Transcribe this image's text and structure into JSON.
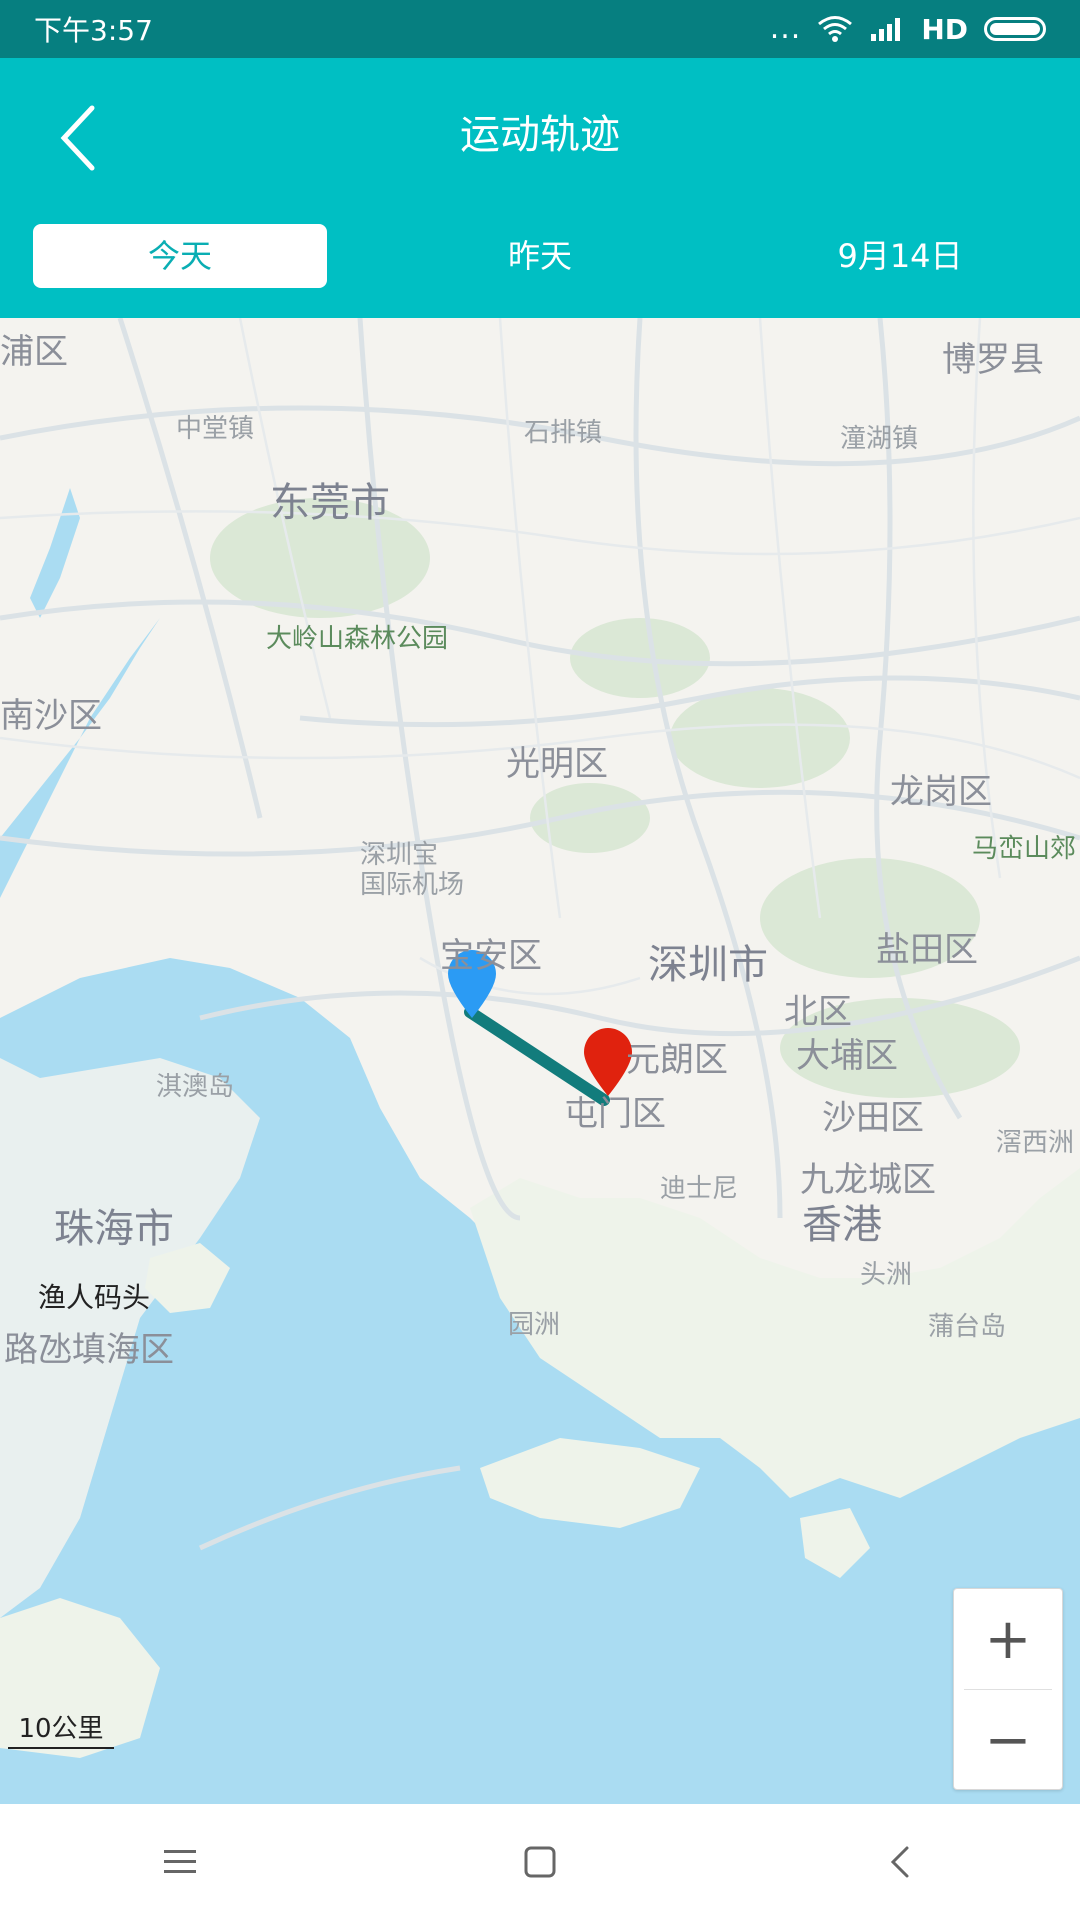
{
  "status": {
    "time": "下午3:57",
    "dots": "...",
    "network": "HD"
  },
  "header": {
    "title": "运动轨迹",
    "back_icon": "chevron-left-icon"
  },
  "tabs": [
    {
      "label": "今天",
      "active": true
    },
    {
      "label": "昨天",
      "active": false
    },
    {
      "label": "9月14日",
      "active": false
    }
  ],
  "map": {
    "labels": {
      "pu": "浦区",
      "boluo": "博罗县",
      "zhongtang": "中堂镇",
      "shipai": "石排镇",
      "tanghu": "潼湖镇",
      "dongguan": "东莞市",
      "daling": "大岭山森林公园",
      "nansha": "南沙区",
      "guangming": "光明区",
      "longgang": "龙岗区",
      "maluanshan": "马峦山郊",
      "airport1": "深圳宝",
      "airport2": "国际机场",
      "baoan": "宝安区",
      "shenzhen": "深圳市",
      "yantian": "盐田区",
      "north": "北区",
      "yuanlang": "元朗区",
      "dapu": "大埔区",
      "qiao": "淇澳岛",
      "tunmen": "屯门区",
      "shatian": "沙田区",
      "xijiao": "滘西洲",
      "disney": "迪士尼",
      "jiulong": "九龙城区",
      "zhuhai": "珠海市",
      "xianggang": "香港",
      "touzhou": "头洲",
      "yuren": "渔人码头",
      "yuanzhou": "园洲",
      "putai": "蒲台岛",
      "lutian": "路氹填海区"
    },
    "start_marker_color": "#2b9bf4",
    "end_marker_color": "#e0220e",
    "track_color": "#127c7c",
    "water_color": "#aadcf2",
    "scale_label": "10公里"
  },
  "zoom": {
    "plus": "+",
    "minus": "−"
  },
  "colors": {
    "status_bar": "#067f80",
    "header": "#00bfc3",
    "active_tab_text": "#0aaeb3"
  }
}
